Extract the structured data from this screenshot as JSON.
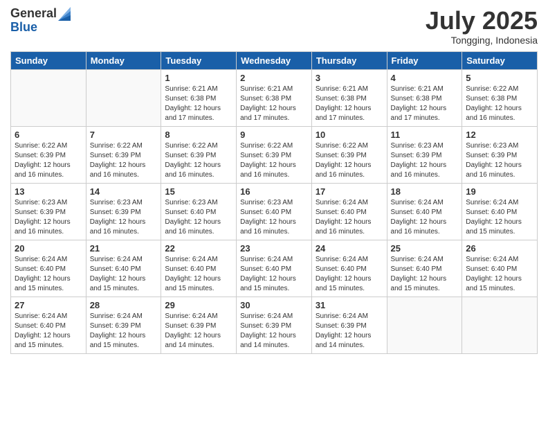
{
  "logo": {
    "general": "General",
    "blue": "Blue"
  },
  "title": "July 2025",
  "location": "Tongging, Indonesia",
  "days_header": [
    "Sunday",
    "Monday",
    "Tuesday",
    "Wednesday",
    "Thursday",
    "Friday",
    "Saturday"
  ],
  "weeks": [
    [
      {
        "day": "",
        "info": ""
      },
      {
        "day": "",
        "info": ""
      },
      {
        "day": "1",
        "info": "Sunrise: 6:21 AM\nSunset: 6:38 PM\nDaylight: 12 hours and 17 minutes."
      },
      {
        "day": "2",
        "info": "Sunrise: 6:21 AM\nSunset: 6:38 PM\nDaylight: 12 hours and 17 minutes."
      },
      {
        "day": "3",
        "info": "Sunrise: 6:21 AM\nSunset: 6:38 PM\nDaylight: 12 hours and 17 minutes."
      },
      {
        "day": "4",
        "info": "Sunrise: 6:21 AM\nSunset: 6:38 PM\nDaylight: 12 hours and 17 minutes."
      },
      {
        "day": "5",
        "info": "Sunrise: 6:22 AM\nSunset: 6:38 PM\nDaylight: 12 hours and 16 minutes."
      }
    ],
    [
      {
        "day": "6",
        "info": "Sunrise: 6:22 AM\nSunset: 6:39 PM\nDaylight: 12 hours and 16 minutes."
      },
      {
        "day": "7",
        "info": "Sunrise: 6:22 AM\nSunset: 6:39 PM\nDaylight: 12 hours and 16 minutes."
      },
      {
        "day": "8",
        "info": "Sunrise: 6:22 AM\nSunset: 6:39 PM\nDaylight: 12 hours and 16 minutes."
      },
      {
        "day": "9",
        "info": "Sunrise: 6:22 AM\nSunset: 6:39 PM\nDaylight: 12 hours and 16 minutes."
      },
      {
        "day": "10",
        "info": "Sunrise: 6:22 AM\nSunset: 6:39 PM\nDaylight: 12 hours and 16 minutes."
      },
      {
        "day": "11",
        "info": "Sunrise: 6:23 AM\nSunset: 6:39 PM\nDaylight: 12 hours and 16 minutes."
      },
      {
        "day": "12",
        "info": "Sunrise: 6:23 AM\nSunset: 6:39 PM\nDaylight: 12 hours and 16 minutes."
      }
    ],
    [
      {
        "day": "13",
        "info": "Sunrise: 6:23 AM\nSunset: 6:39 PM\nDaylight: 12 hours and 16 minutes."
      },
      {
        "day": "14",
        "info": "Sunrise: 6:23 AM\nSunset: 6:39 PM\nDaylight: 12 hours and 16 minutes."
      },
      {
        "day": "15",
        "info": "Sunrise: 6:23 AM\nSunset: 6:40 PM\nDaylight: 12 hours and 16 minutes."
      },
      {
        "day": "16",
        "info": "Sunrise: 6:23 AM\nSunset: 6:40 PM\nDaylight: 12 hours and 16 minutes."
      },
      {
        "day": "17",
        "info": "Sunrise: 6:24 AM\nSunset: 6:40 PM\nDaylight: 12 hours and 16 minutes."
      },
      {
        "day": "18",
        "info": "Sunrise: 6:24 AM\nSunset: 6:40 PM\nDaylight: 12 hours and 16 minutes."
      },
      {
        "day": "19",
        "info": "Sunrise: 6:24 AM\nSunset: 6:40 PM\nDaylight: 12 hours and 15 minutes."
      }
    ],
    [
      {
        "day": "20",
        "info": "Sunrise: 6:24 AM\nSunset: 6:40 PM\nDaylight: 12 hours and 15 minutes."
      },
      {
        "day": "21",
        "info": "Sunrise: 6:24 AM\nSunset: 6:40 PM\nDaylight: 12 hours and 15 minutes."
      },
      {
        "day": "22",
        "info": "Sunrise: 6:24 AM\nSunset: 6:40 PM\nDaylight: 12 hours and 15 minutes."
      },
      {
        "day": "23",
        "info": "Sunrise: 6:24 AM\nSunset: 6:40 PM\nDaylight: 12 hours and 15 minutes."
      },
      {
        "day": "24",
        "info": "Sunrise: 6:24 AM\nSunset: 6:40 PM\nDaylight: 12 hours and 15 minutes."
      },
      {
        "day": "25",
        "info": "Sunrise: 6:24 AM\nSunset: 6:40 PM\nDaylight: 12 hours and 15 minutes."
      },
      {
        "day": "26",
        "info": "Sunrise: 6:24 AM\nSunset: 6:40 PM\nDaylight: 12 hours and 15 minutes."
      }
    ],
    [
      {
        "day": "27",
        "info": "Sunrise: 6:24 AM\nSunset: 6:40 PM\nDaylight: 12 hours and 15 minutes."
      },
      {
        "day": "28",
        "info": "Sunrise: 6:24 AM\nSunset: 6:39 PM\nDaylight: 12 hours and 15 minutes."
      },
      {
        "day": "29",
        "info": "Sunrise: 6:24 AM\nSunset: 6:39 PM\nDaylight: 12 hours and 14 minutes."
      },
      {
        "day": "30",
        "info": "Sunrise: 6:24 AM\nSunset: 6:39 PM\nDaylight: 12 hours and 14 minutes."
      },
      {
        "day": "31",
        "info": "Sunrise: 6:24 AM\nSunset: 6:39 PM\nDaylight: 12 hours and 14 minutes."
      },
      {
        "day": "",
        "info": ""
      },
      {
        "day": "",
        "info": ""
      }
    ]
  ]
}
